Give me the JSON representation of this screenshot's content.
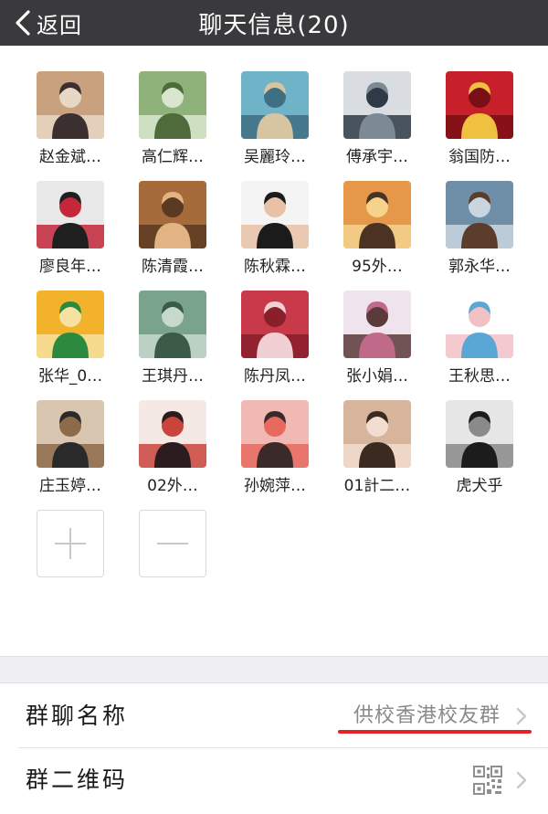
{
  "nav": {
    "back_label": "返回",
    "title": "聊天信息(20)"
  },
  "members": [
    {
      "name": "赵金斌…",
      "icon": "avatar-photo"
    },
    {
      "name": "高仁辉…",
      "icon": "avatar-photo"
    },
    {
      "name": "吴麗玲…",
      "icon": "avatar-photo"
    },
    {
      "name": "傅承宇…",
      "icon": "avatar-photo"
    },
    {
      "name": "翁国防…",
      "icon": "avatar-photo"
    },
    {
      "name": "廖良年…",
      "icon": "avatar-photo"
    },
    {
      "name": "陈清霞…",
      "icon": "avatar-photo"
    },
    {
      "name": "陈秋霖…",
      "icon": "avatar-cartoon"
    },
    {
      "name": "95外…",
      "icon": "avatar-photo"
    },
    {
      "name": "郭永华…",
      "icon": "avatar-photo"
    },
    {
      "name": "张华_0…",
      "icon": "avatar-cartoon"
    },
    {
      "name": "王琪丹…",
      "icon": "avatar-photo"
    },
    {
      "name": "陈丹凤…",
      "icon": "avatar-photo"
    },
    {
      "name": "张小娟…",
      "icon": "avatar-photo"
    },
    {
      "name": "王秋思…",
      "icon": "avatar-cartoon"
    },
    {
      "name": "庄玉婷…",
      "icon": "avatar-photo"
    },
    {
      "name": "02外…",
      "icon": "avatar-photo"
    },
    {
      "name": "孙婉萍…",
      "icon": "avatar-cartoon"
    },
    {
      "name": "01計二…",
      "icon": "avatar-photo"
    },
    {
      "name": "虎犬乎",
      "icon": "avatar-cartoon"
    }
  ],
  "controls": {
    "add_icon": "plus-icon",
    "remove_icon": "minus-icon"
  },
  "settings": {
    "group_name_label": "群聊名称",
    "group_name_value": "供校香港校友群",
    "qr_label": "群二维码",
    "qr_icon": "qr-code-icon"
  },
  "colors": {
    "navbar": "#3a3a3c",
    "highlight_underline": "#e2232a",
    "section_bg": "#efeff4"
  }
}
